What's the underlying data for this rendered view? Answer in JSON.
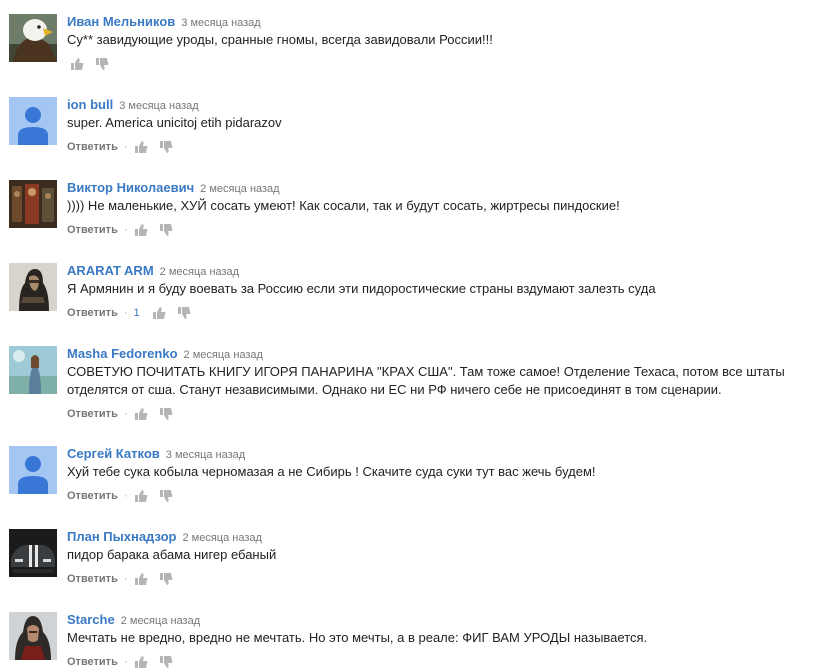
{
  "reply_label": "Ответить",
  "separator": "·",
  "comments": [
    {
      "author": "Иван Мельников",
      "time": "3 месяца назад",
      "text": "Су** завидующие уроды, сранные гномы, всегда завидовали России!!!",
      "avatar": "eagle-avatar",
      "has_reply": false,
      "likes": ""
    },
    {
      "author": "ion bull",
      "time": "3 месяца назад",
      "text": "super. America unicitoj etih pidarazov",
      "avatar": "default-avatar",
      "has_reply": true,
      "likes": ""
    },
    {
      "author": "Виктор Николаевич",
      "time": "2 месяца назад",
      "text": ")))) Не маленькие, ХУЙ сосать умеют! Как сосали, так и будут сосать, жиртресы пиндоские!",
      "avatar": "painting-avatar",
      "has_reply": true,
      "likes": ""
    },
    {
      "author": "ARARAT ARM",
      "time": "2 месяца назад",
      "text": "Я Армянин и я буду воевать за Россию если эти пидоростические  страны вздумают залезть суда",
      "avatar": "hooded-figure-avatar",
      "has_reply": true,
      "likes": "1"
    },
    {
      "author": "Masha Fedorenko",
      "time": "2 месяца назад",
      "text": "СОВЕТУЮ ПОЧИТАТЬ КНИГУ ИГОРЯ ПАНАРИНА \"КРАХ США\". Там тоже самое! Отделение Техаса, потом все штаты отделятся от сша. Станут независимыми. Однако ни ЕС ни РФ ничего себе не присоединят в том сценарии.",
      "avatar": "woman-avatar",
      "has_reply": true,
      "likes": ""
    },
    {
      "author": "Сергей Катков",
      "time": "3 месяца назад",
      "text": "Хуй тебе сука кобыла черномазая а не Сибирь ! Скачите суда суки тут вас жечь будем!",
      "avatar": "default-avatar",
      "has_reply": true,
      "likes": ""
    },
    {
      "author": "План Пыхнадзор",
      "time": "2 месяца назад",
      "text": "пидор барака абама нигер ебаный",
      "avatar": "car-avatar",
      "has_reply": true,
      "likes": ""
    },
    {
      "author": "Starche",
      "time": "2 месяца назад",
      "text": "Мечтать не вредно, вредно не мечтать. Но это мечты, а в реале: ФИГ ВАМ УРОДЫ называется.",
      "avatar": "assassin-avatar",
      "has_reply": true,
      "likes": ""
    }
  ]
}
